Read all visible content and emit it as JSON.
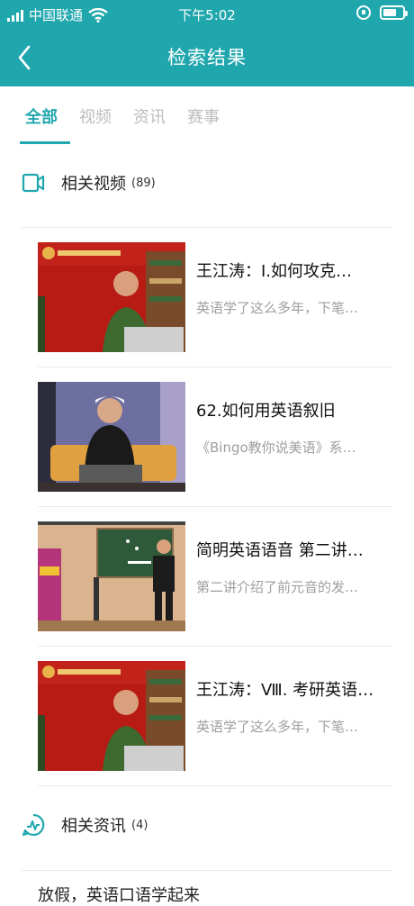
{
  "status": {
    "carrier": "中国联通",
    "time": "下午5:02",
    "battery_level": 0.7
  },
  "header": {
    "title": "检索结果",
    "back_icon": "chevron-left-icon"
  },
  "tabs": [
    {
      "label": "全部",
      "active": true
    },
    {
      "label": "视频",
      "active": false
    },
    {
      "label": "资讯",
      "active": false
    },
    {
      "label": "赛事",
      "active": false
    }
  ],
  "videos_section": {
    "icon": "video-camera-icon",
    "title": "相关视频",
    "count": "(89)",
    "items": [
      {
        "title": "王江涛：Ⅰ.如何攻克…",
        "desc": "英语学了这么多年，下笔…"
      },
      {
        "title": "62.如何用英语叙旧",
        "desc": "《Bingo教你说美语》系…"
      },
      {
        "title": "简明英语语音 第二讲…",
        "desc": "第二讲介绍了前元音的发…"
      },
      {
        "title": "王江涛：Ⅷ. 考研英语…",
        "desc": "英语学了这么多年，下笔…"
      }
    ]
  },
  "news_section": {
    "icon": "news-pulse-icon",
    "title": "相关资讯",
    "count": "(4)",
    "first_item": "放假，英语口语学起来"
  },
  "colors": {
    "accent": "#1fa7ad",
    "muted_text": "#9e9e9e",
    "tab_inactive": "#bdbdbd"
  }
}
